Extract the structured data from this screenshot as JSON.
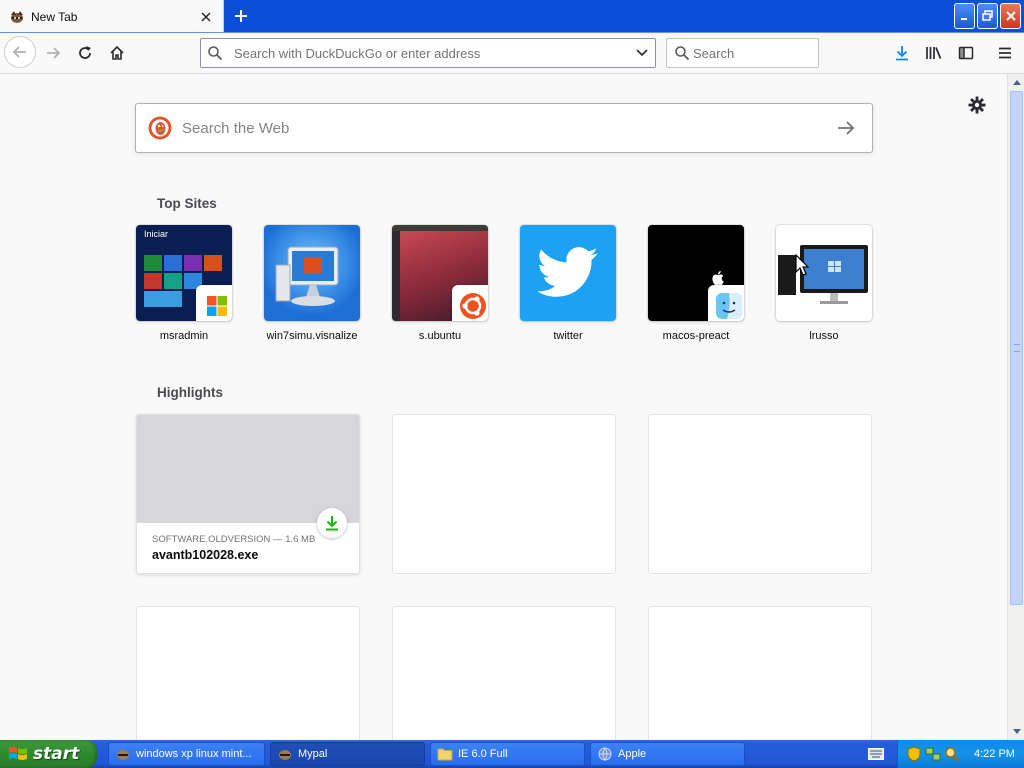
{
  "tab": {
    "title": "New Tab",
    "favicon": "raccoon-icon"
  },
  "toolbar": {
    "url_placeholder": "Search with DuckDuckGo or enter address",
    "search_placeholder": "Search",
    "icons": [
      "back-icon",
      "forward-icon",
      "reload-icon",
      "home-icon",
      "download-icon",
      "library-icon",
      "sidebar-icon",
      "menu-icon"
    ]
  },
  "newtab": {
    "search_placeholder": "Search the Web",
    "top_sites_heading": "Top Sites",
    "highlights_heading": "Highlights",
    "top_sites": [
      {
        "label": "msradmin",
        "tile_color": "#0b1e52",
        "badge": "windows-logo-icon",
        "screenshot_text": "Iniciar"
      },
      {
        "label": "win7simu.visnalize",
        "tile_color": "#1d6fd6",
        "badge": ""
      },
      {
        "label": "s.ubuntu",
        "tile_color": "#8a2a3a",
        "badge": "ubuntu-logo-icon"
      },
      {
        "label": "twitter",
        "tile_color": "#1da1f2",
        "badge": ""
      },
      {
        "label": "macos-preact",
        "tile_color": "#000000",
        "badge": "finder-icon"
      },
      {
        "label": "lrusso",
        "tile_color": "#ffffff",
        "badge": ""
      }
    ],
    "highlights": [
      {
        "meta": "SOFTWARE.OLDVERSION — 1.6 MB",
        "filename": "avantb102028.exe",
        "type": "download"
      }
    ]
  },
  "taskbar": {
    "start_label": "start",
    "items": [
      {
        "label": "windows xp linux mint...",
        "icon": "raccoon-icon",
        "active": false
      },
      {
        "label": "Mypal",
        "icon": "raccoon-icon",
        "active": true
      },
      {
        "label": "IE 6.0 Full",
        "icon": "folder-icon",
        "active": false
      },
      {
        "label": "Apple",
        "icon": "globe-icon",
        "active": false
      }
    ],
    "clock": "4:22 PM"
  },
  "colors": {
    "titlebar": "#0a4fd8",
    "accent": "#0a84ff",
    "download_green": "#12bc00",
    "taskbar": "#245dda"
  }
}
